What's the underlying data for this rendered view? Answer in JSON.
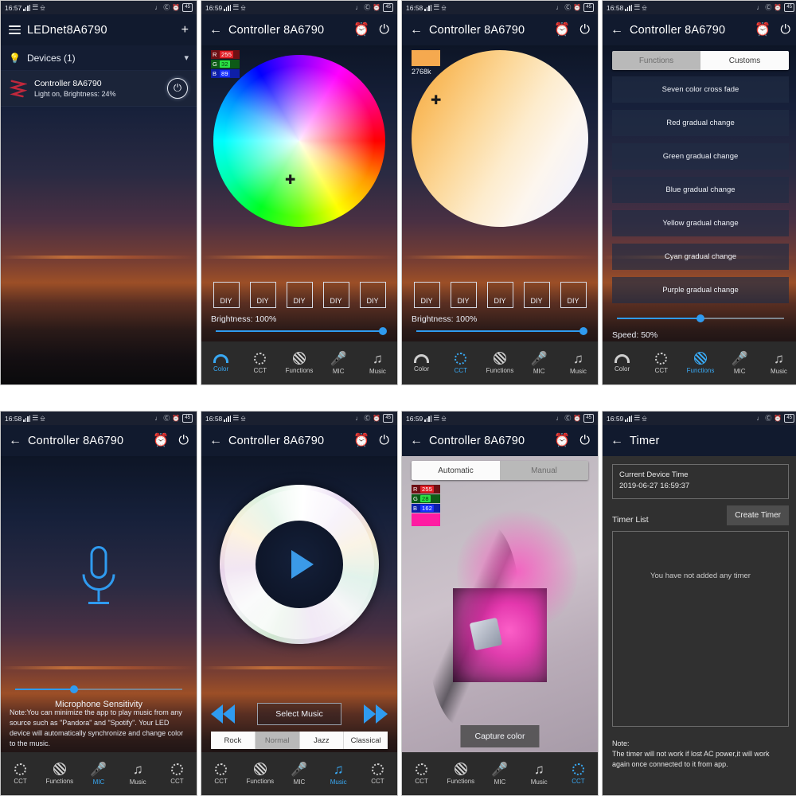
{
  "statusbar": {
    "icons": {
      "signal": "signal-bars",
      "wifi": "wifi-icon",
      "bt": "bluetooth-icon",
      "mute": "mute-icon",
      "dnd": "dnd-icon",
      "alarm": "alarm-icon"
    },
    "battery": "45"
  },
  "panel1": {
    "time": "16:57",
    "title": "LEDnet8A6790",
    "menu_icon": "hamburger-icon",
    "add_label": "+",
    "group": {
      "label": "Devices (1)",
      "bulb_icon": "bulb-icon",
      "chevron": "chevron-down-icon"
    },
    "device": {
      "name": "Controller  8A6790",
      "status": "Light on, Brightness: 24%",
      "power_icon": "power-icon"
    }
  },
  "panel2": {
    "time": "16:59",
    "title": "Controller 8A6790",
    "back_icon": "back-arrow-icon",
    "timer_icon": "alarm-clock-icon",
    "power_icon": "power-icon",
    "rgb": {
      "r_key": "R",
      "r_val": "255",
      "g_key": "G",
      "g_val": "32",
      "b_key": "B",
      "b_val": "89"
    },
    "diy": [
      "DIY",
      "DIY",
      "DIY",
      "DIY",
      "DIY"
    ],
    "brightness_label": "Brightness: 100%",
    "brightness_pct": 100,
    "nav": [
      {
        "label": "Color",
        "icon": "rainbow-icon",
        "active": true
      },
      {
        "label": "CCT",
        "icon": "sun-icon",
        "active": false
      },
      {
        "label": "Functions",
        "icon": "hatch-circle-icon",
        "active": false
      },
      {
        "label": "MIC",
        "icon": "microphone-icon",
        "active": false
      },
      {
        "label": "Music",
        "icon": "music-note-icon",
        "active": false
      }
    ]
  },
  "panel3": {
    "time": "16:58",
    "title": "Controller 8A6790",
    "kelvin": "2768k",
    "diy": [
      "DIY",
      "DIY",
      "DIY",
      "DIY",
      "DIY"
    ],
    "brightness_label": "Brightness: 100%",
    "brightness_pct": 100,
    "nav": [
      {
        "label": "Color",
        "icon": "rainbow-icon",
        "active": false
      },
      {
        "label": "CCT",
        "icon": "sun-icon",
        "active": true
      },
      {
        "label": "Functions",
        "icon": "hatch-circle-icon",
        "active": false
      },
      {
        "label": "MIC",
        "icon": "microphone-icon",
        "active": false
      },
      {
        "label": "Music",
        "icon": "music-note-icon",
        "active": false
      }
    ]
  },
  "panel4": {
    "time": "16:58",
    "title": "Controller 8A6790",
    "tabs": [
      {
        "label": "Functions",
        "selected": true
      },
      {
        "label": "Customs",
        "selected": false
      }
    ],
    "functions": [
      "Seven color cross fade",
      "Red gradual change",
      "Green gradual change",
      "Blue gradual change",
      "Yellow gradual change",
      "Cyan gradual change",
      "Purple gradual change"
    ],
    "speed_label": "Speed: 50%",
    "speed_pct": 50,
    "nav": [
      {
        "label": "Color",
        "icon": "rainbow-icon",
        "active": false
      },
      {
        "label": "CCT",
        "icon": "sun-icon",
        "active": false
      },
      {
        "label": "Functions",
        "icon": "hatch-circle-icon",
        "active": true
      },
      {
        "label": "MIC",
        "icon": "microphone-icon",
        "active": false
      },
      {
        "label": "Music",
        "icon": "music-note-icon",
        "active": false
      }
    ]
  },
  "panel5": {
    "time": "16:58",
    "title": "Controller 8A6790",
    "mic_icon": "microphone-large-icon",
    "sensitivity_label": "Microphone Sensitivity",
    "sensitivity_pct": 35,
    "note": "Note:You can minimize the app to play music from any source such as \"Pandora\" and \"Spotify\". Your LED device will automatically synchronize and change color to the music.",
    "nav": [
      {
        "label": "CCT",
        "icon": "sun-icon",
        "active": false
      },
      {
        "label": "Functions",
        "icon": "hatch-circle-icon",
        "active": false
      },
      {
        "label": "MIC",
        "icon": "microphone-icon",
        "active": true
      },
      {
        "label": "Music",
        "icon": "music-note-icon",
        "active": false
      },
      {
        "label": "CCT",
        "icon": "sun-icon",
        "active": false
      }
    ]
  },
  "panel6": {
    "time": "16:58",
    "title": "Controller 8A6790",
    "play_icon": "play-icon",
    "prev_icon": "rewind-icon",
    "next_icon": "fast-forward-icon",
    "select_music_label": "Select Music",
    "genres": [
      {
        "label": "Rock",
        "selected": false
      },
      {
        "label": "Normal",
        "selected": true
      },
      {
        "label": "Jazz",
        "selected": false
      },
      {
        "label": "Classical",
        "selected": false
      }
    ],
    "nav": [
      {
        "label": "CCT",
        "icon": "sun-icon",
        "active": false
      },
      {
        "label": "Functions",
        "icon": "hatch-circle-icon",
        "active": false
      },
      {
        "label": "MIC",
        "icon": "microphone-icon",
        "active": false
      },
      {
        "label": "Music",
        "icon": "music-note-icon",
        "active": true
      },
      {
        "label": "CCT",
        "icon": "sun-icon",
        "active": false
      }
    ]
  },
  "panel7": {
    "time": "16:59",
    "title": "Controller 8A6790",
    "tabs": [
      {
        "label": "Automatic",
        "selected": true
      },
      {
        "label": "Manual",
        "selected": false
      }
    ],
    "rgb": {
      "r_key": "R",
      "r_val": "255",
      "g_key": "G",
      "g_val": "28",
      "b_key": "B",
      "b_val": "162"
    },
    "swatch_color": "#ff1ca2",
    "capture_label": "Capture color",
    "nav": [
      {
        "label": "CCT",
        "icon": "sun-icon",
        "active": false
      },
      {
        "label": "Functions",
        "icon": "hatch-circle-icon",
        "active": false
      },
      {
        "label": "MIC",
        "icon": "microphone-icon",
        "active": false
      },
      {
        "label": "Music",
        "icon": "music-note-icon",
        "active": false
      },
      {
        "label": "CCT",
        "icon": "sun-icon",
        "active": true
      }
    ]
  },
  "panel8": {
    "time": "16:59",
    "title": "Timer",
    "current_time_label": "Current Device Time",
    "current_time_value": "2019-06-27 16:59:37",
    "timer_list_label": "Timer List",
    "create_timer_label": "Create Timer",
    "empty_label": "You have not added any timer",
    "note_title": "Note:",
    "note_body": "The timer will not work if lost AC power,it will work again once connected to it from app."
  },
  "colors": {
    "accent": "#2f9bf0",
    "appbar": "#111a2e",
    "nav_bg": "#2b2b2b",
    "timer_bg": "#303030"
  }
}
